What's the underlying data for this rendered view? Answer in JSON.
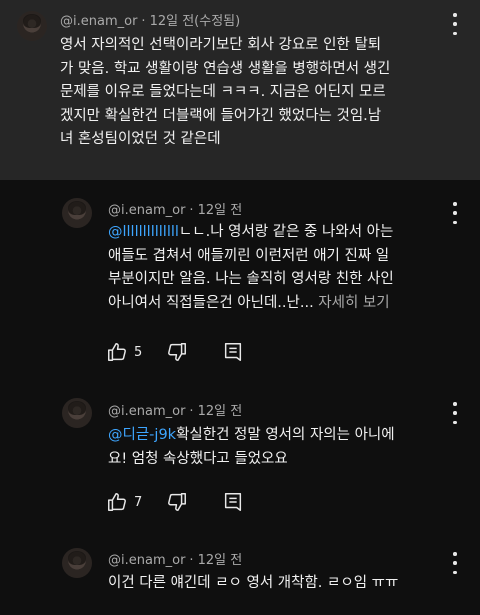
{
  "comments": [
    {
      "author": "@i.enam_or",
      "time": "12일 전(수정됨)",
      "text_lines": [
        "영서 자의적인 선택이라기보단 회사 강요로 인한 탈퇴",
        "가 맞음. 학교 생활이랑 연습생 생활을 병행하면서 생긴",
        "문제를 이유로 들었다는데 ㅋㅋㅋ. 지금은 어딘지 모르",
        "겠지만 확실한건 더블랙에 들어가긴 했었다는 것임.남",
        "녀 혼성팀이었던 것 같은데"
      ]
    },
    {
      "author": "@i.enam_or",
      "time": "12일 전",
      "mention": "@llllllllllllll",
      "text_lines": [
        "ㄴㄴ.나 영서랑 같은 중 나와서 아는",
        "애들도 겹쳐서 애들끼린 이런저런 애기 진짜 일",
        "부분이지만 알음.  나는 솔직히 영서랑 친한 사인",
        "아니여서 직접들은건 아닌데..난..."
      ],
      "more_label": "자세히 보기",
      "likes": "5"
    },
    {
      "author": "@i.enam_or",
      "time": "12일 전",
      "mention": "@디귿-j9k",
      "text_lines": [
        "확실한건 정말 영서의 자의는 아니에",
        "요! 엄청 속상했다고 들었오요"
      ],
      "likes": "7"
    },
    {
      "author": "@i.enam_or",
      "time": "12일 전",
      "text_lines": [
        "이건 다른 얘긴데 ㄹㅇ 영서 개착함. ㄹㅇ임 ㅠㅠ"
      ]
    }
  ],
  "icons": [
    "avatar",
    "more-vert-icon",
    "thumb-up-icon",
    "thumb-down-icon",
    "reply-icon"
  ]
}
